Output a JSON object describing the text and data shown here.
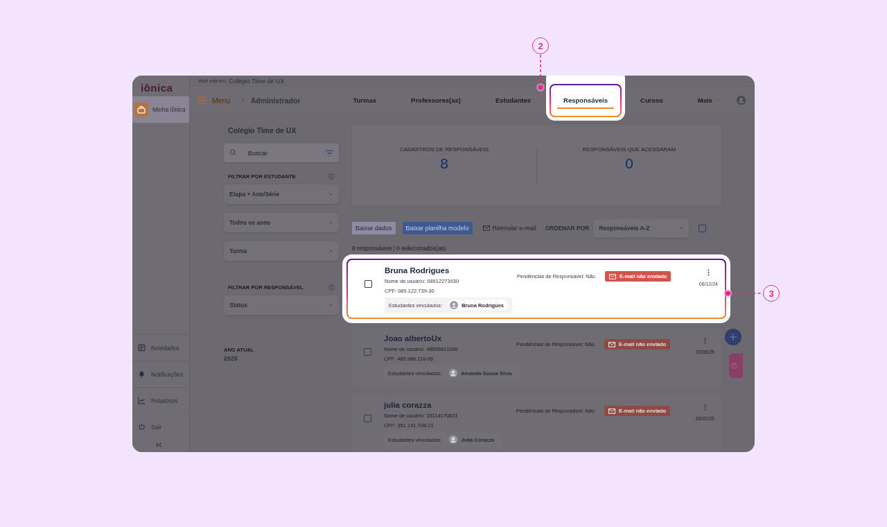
{
  "breadcrumb": {
    "label": "Você está em:",
    "value": "Colégio Time de UX"
  },
  "sidebar": {
    "logo": "iônica",
    "top_items": [
      {
        "label": "Minha iônica",
        "selected": true
      }
    ],
    "bottom_items": [
      {
        "label": "Novidades"
      },
      {
        "label": "Notificações"
      },
      {
        "label": "Relatórios"
      },
      {
        "label": "Sair"
      }
    ]
  },
  "nav": {
    "menu": "Menu",
    "section": "Administrador",
    "tabs": [
      {
        "label": "Turmas",
        "selected": false,
        "highlighted": false,
        "kind": "plain"
      },
      {
        "label": "Professores(as)",
        "selected": false,
        "highlighted": false,
        "kind": "plain"
      },
      {
        "label": "Estudantes",
        "selected": false,
        "highlighted": false,
        "kind": "plain"
      },
      {
        "label": "Responsáveis",
        "selected": true,
        "highlighted": true,
        "kind": "plain"
      },
      {
        "label": "Cursos",
        "selected": false,
        "highlighted": false,
        "kind": "plain"
      },
      {
        "label": "Mais",
        "selected": false,
        "highlighted": false,
        "kind": "dropdown"
      }
    ]
  },
  "filters": {
    "title": "Colégio Time de UX",
    "search": {
      "placeholder": "Buscar"
    },
    "groups": [
      {
        "heading": "FILTRAR POR ESTUDANTE",
        "selects": [
          "Etapa + Ano/Série",
          "Todos os anos",
          "Turma"
        ]
      },
      {
        "heading": "FILTRAR POR RESPONSÁVEL",
        "selects": [
          "Status"
        ]
      }
    ],
    "year": {
      "label": "ANO ATUAL",
      "value": "2025"
    }
  },
  "stats": [
    {
      "label": "CADASTROS DE RESPONSÁVEIS",
      "value": "8"
    },
    {
      "label": "RESPONSÁVEIS QUE ACESSARAM",
      "value": "0"
    }
  ],
  "toolbar": {
    "buttons": [
      {
        "label": "Baixar dados",
        "kind": "primary",
        "disabled": true
      },
      {
        "label": "Baixar planilha modelo",
        "kind": "primary",
        "disabled": false
      },
      {
        "label": "Reenviar e-mail",
        "kind": "link",
        "disabled": true
      }
    ],
    "sort_label": "ORDENAR POR",
    "sort_value": "Responsáveis A-Z",
    "select_all_checked": false
  },
  "summary": "8 responsáveis | 0 selecionados(as)",
  "guardians": [
    {
      "name": "Bruna Rodrigues",
      "username": "Nome de usuário: 08912273930",
      "cpf": "CPF: 089.122.739-30",
      "linked_label": "Estudantes vinculados:",
      "linked_student": "Bruna Rodrigues",
      "pending": "Pendências de Responsável: Não",
      "status": "E-mail não enviado",
      "date": "06/12/24",
      "checked": false,
      "highlighted": true
    },
    {
      "name": "Joao albertoUx",
      "username": "Nome de usuário: 48596611096",
      "cpf": "CPF: 485.966.110-96",
      "linked_label": "Estudantes vinculados:",
      "linked_student": "Amanda Souza Silva",
      "pending": "Pendências de Responsável: Não",
      "status": "E-mail não enviado",
      "date": "03/06/25",
      "checked": false,
      "highlighted": false
    },
    {
      "name": "julia corazza",
      "username": "Nome de usuário: 35114170821",
      "cpf": "CPF: 351.141.708-21",
      "linked_label": "Estudantes vinculados:",
      "linked_student": "Julia Corazza",
      "pending": "Pendências de Responsável: Não",
      "status": "E-mail não enviado",
      "date": "20/02/25",
      "checked": false,
      "highlighted": false
    }
  ],
  "annotations": [
    {
      "label": "2"
    },
    {
      "label": "3"
    }
  ]
}
